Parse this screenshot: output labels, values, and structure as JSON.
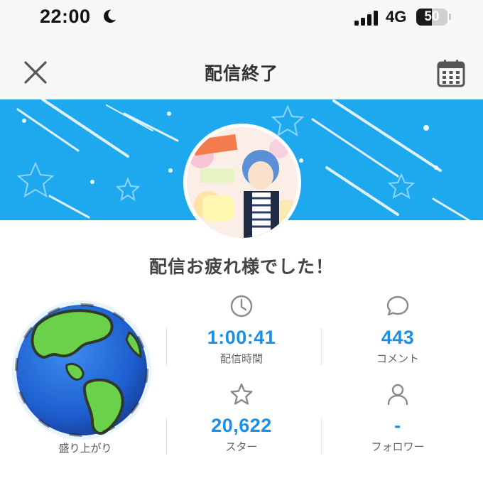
{
  "status_bar": {
    "time": "22:00",
    "network": "4G",
    "battery_level": "50",
    "battery_fraction": 0.5
  },
  "nav": {
    "title": "配信終了"
  },
  "message": "配信お疲れ様でした！",
  "earth_label": "盛り上がり",
  "stats": {
    "duration": {
      "value": "1:00:41",
      "label": "配信時間",
      "icon": "clock-icon"
    },
    "comments": {
      "value": "443",
      "label": "コメント",
      "icon": "comment-icon"
    },
    "stars": {
      "value": "20,622",
      "label": "スター",
      "icon": "star-icon"
    },
    "followers": {
      "value": "-",
      "label": "フォロワー",
      "icon": "person-icon"
    }
  },
  "colors": {
    "accent": "#1a8fe8",
    "banner": "#1ea8ee",
    "background": "#ffffff",
    "header_bg": "#f7f7f7"
  }
}
